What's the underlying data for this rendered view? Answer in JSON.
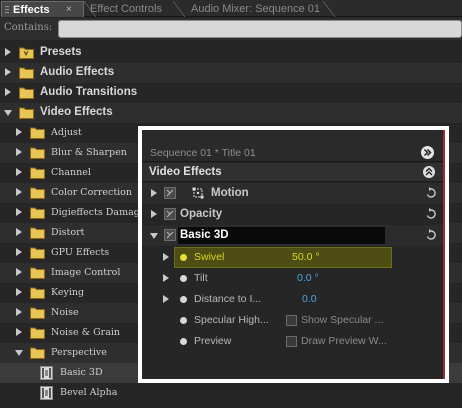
{
  "tabs": {
    "effects": "Effects",
    "effects_close": "×",
    "effect_controls": "Effect Controls",
    "audio_mixer": "Audio Mixer: Sequence 01"
  },
  "search": {
    "label": "Contains:",
    "value": ""
  },
  "tree": {
    "presets": "Presets",
    "audio_effects": "Audio Effects",
    "audio_transitions": "Audio Transitions",
    "video_effects": "Video Effects",
    "video_folders": [
      "Adjust",
      "Blur & Sharpen",
      "Channel",
      "Color Correction",
      "Digieffects Damage",
      "Distort",
      "GPU Effects",
      "Image Control",
      "Keying",
      "Noise",
      "Noise & Grain",
      "Perspective"
    ],
    "perspective_items": [
      "Basic 3D",
      "Bevel Alpha"
    ]
  },
  "effect_controls": {
    "sequence_title": "Sequence 01 * Title 01",
    "section_label": "Video Effects",
    "effects": {
      "motion": "Motion",
      "opacity": "Opacity",
      "basic3d": "Basic 3D"
    },
    "params": {
      "swivel": {
        "label": "Swivel",
        "value": "50.0 °"
      },
      "tilt": {
        "label": "Tilt",
        "value": "0.0 °"
      },
      "distance": {
        "label": "Distance to I...",
        "value": "0.0"
      },
      "specular": {
        "label": "Specular High...",
        "checkbox": "Show Specular ..."
      },
      "preview": {
        "label": "Preview",
        "checkbox": "Draw Preview W..."
      }
    }
  },
  "colors": {
    "param_value": "#49a3e4",
    "swivel_highlight": "#dada1e",
    "folder": "#e9c457",
    "inset_border": "#ffffff",
    "accent_line": "#a4282c"
  }
}
